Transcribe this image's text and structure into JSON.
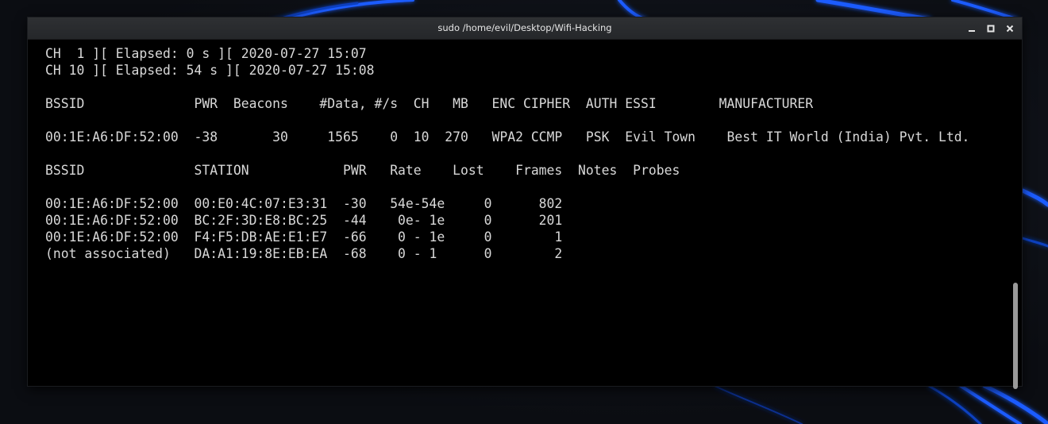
{
  "window": {
    "title": "sudo /home/evil/Desktop/Wifi-Hacking",
    "controls": [
      "minimize-icon",
      "maximize-icon",
      "close-icon"
    ]
  },
  "terminal": {
    "status_lines": [
      "CH  1 ][ Elapsed: 0 s ][ 2020-07-27 15:07",
      "CH 10 ][ Elapsed: 54 s ][ 2020-07-27 15:08"
    ],
    "ap_header": "BSSID              PWR  Beacons    #Data, #/s  CH   MB   ENC CIPHER  AUTH ESSI        MANUFACTURER",
    "ap_rows": [
      "00:1E:A6:DF:52:00  -38       30     1565    0  10  270   WPA2 CCMP   PSK  Evil Town    Best IT World (India) Pvt. Ltd."
    ],
    "station_header": "BSSID              STATION            PWR   Rate    Lost    Frames  Notes  Probes",
    "station_rows": [
      "00:1E:A6:DF:52:00  00:E0:4C:07:E3:31  -30   54e-54e     0      802",
      "00:1E:A6:DF:52:00  BC:2F:3D:E8:BC:25  -44    0e- 1e     0      201",
      "00:1E:A6:DF:52:00  F4:F5:DB:AE:E1:E7  -66    0 - 1e     0        1",
      "(not associated)   DA:A1:19:8E:EB:EA  -68    0 - 1      0        2"
    ]
  },
  "colors": {
    "terminal_bg": "#000000",
    "terminal_fg": "#d8d8d8",
    "wallpaper_accent": "#1a5cff"
  }
}
